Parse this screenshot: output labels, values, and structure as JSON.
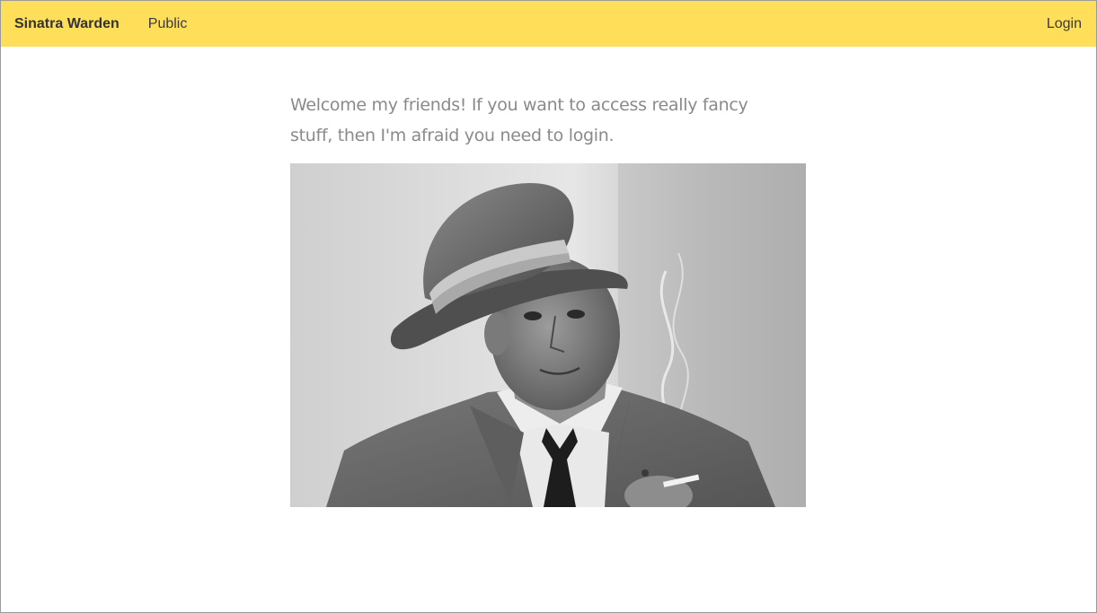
{
  "navbar": {
    "brand": "Sinatra Warden",
    "links": [
      {
        "label": "Public"
      }
    ],
    "login_label": "Login",
    "background_color": "#ffde59"
  },
  "main": {
    "welcome_text": "Welcome my friends! If you want to access really fancy stuff, then I'm afraid you need to login.",
    "photo": {
      "subject": "black-and-white portrait photo of a man in a fedora hat and suit holding a cigarette"
    }
  }
}
